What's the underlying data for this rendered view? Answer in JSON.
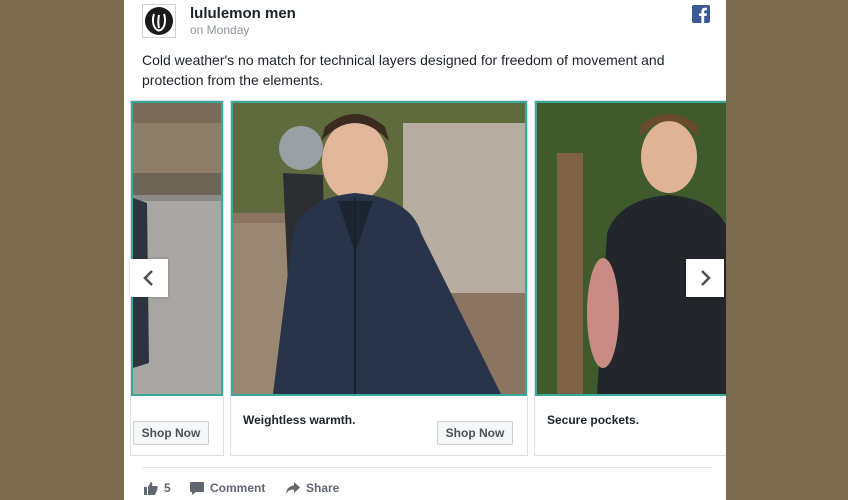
{
  "post": {
    "page_name": "lululemon men",
    "time": "on Monday",
    "caption": "Cold weather's no match for technical layers designed for freedom of movement and protection from the elements."
  },
  "carousel": {
    "cards": [
      {
        "label": "",
        "cta": "Shop Now"
      },
      {
        "label": "Weightless warmth.",
        "cta": "Shop Now"
      },
      {
        "label": "Secure pockets.",
        "cta": ""
      }
    ]
  },
  "actions": {
    "likes": "5",
    "comment": "Comment",
    "share": "Share"
  },
  "icons": [
    "lululemon-logo-icon",
    "facebook-icon",
    "chevron-left-icon",
    "chevron-right-icon",
    "thumbs-up-icon",
    "comment-icon",
    "share-icon"
  ],
  "colors": {
    "background": "#7c6a4e",
    "card_border_accent": "#3aa898",
    "facebook_blue": "#3b5998"
  }
}
